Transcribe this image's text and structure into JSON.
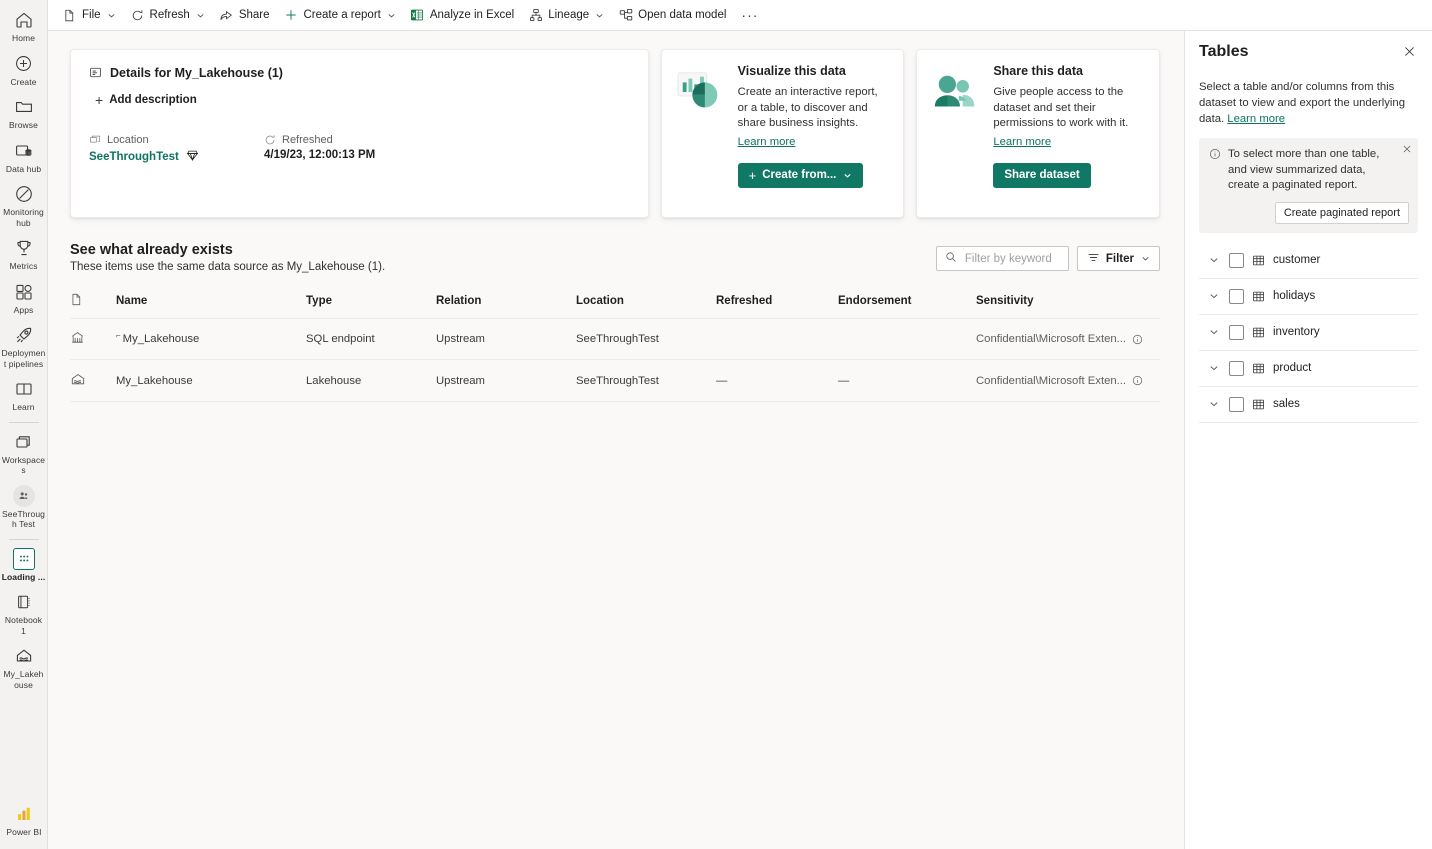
{
  "rail": {
    "items": [
      {
        "label": "Home",
        "icon": "home-icon",
        "active": false
      },
      {
        "label": "Create",
        "icon": "create-plus-icon",
        "active": false
      },
      {
        "label": "Browse",
        "icon": "folder-icon",
        "active": false
      },
      {
        "label": "Data hub",
        "icon": "data-hub-icon",
        "active": false
      },
      {
        "label": "Monitoring hub",
        "icon": "monitoring-hub-icon",
        "active": false
      },
      {
        "label": "Metrics",
        "icon": "trophy-icon",
        "active": false
      },
      {
        "label": "Apps",
        "icon": "apps-grid-icon",
        "active": false
      },
      {
        "label": "Deployment pipelines",
        "icon": "deployment-pipelines-icon",
        "active": false
      },
      {
        "label": "Learn",
        "icon": "book-icon",
        "active": false
      }
    ],
    "items2": [
      {
        "label": "Workspaces",
        "icon": "workspaces-icon",
        "active": false
      },
      {
        "label": "SeeThrough Test",
        "icon": "workspace-avatar-icon",
        "active": false
      }
    ],
    "items3": [
      {
        "label": "Loading ...",
        "icon": "dataset-icon",
        "active": true
      },
      {
        "label": "Notebook 1",
        "icon": "notebook-icon",
        "active": false
      },
      {
        "label": "My_Lakehouse",
        "icon": "lakehouse-icon",
        "active": false
      }
    ],
    "footer": {
      "label": "Power BI",
      "icon": "power-bi-logo-icon"
    }
  },
  "toolbar": {
    "items": [
      {
        "label": "File",
        "icon": "file-icon",
        "chevron": true
      },
      {
        "label": "Refresh",
        "icon": "refresh-icon",
        "chevron": true
      },
      {
        "label": "Share",
        "icon": "share-icon",
        "chevron": false
      },
      {
        "label": "Create a report",
        "icon": "plus-icon",
        "chevron": true
      },
      {
        "label": "Analyze in Excel",
        "icon": "excel-icon",
        "chevron": false
      },
      {
        "label": "Lineage",
        "icon": "lineage-icon",
        "chevron": true
      },
      {
        "label": "Open data model",
        "icon": "data-model-icon",
        "chevron": false
      }
    ],
    "overflow_label": "···"
  },
  "details": {
    "title": "Details for My_Lakehouse (1)",
    "add_description": "Add description",
    "location_label": "Location",
    "location_value": "SeeThroughTest",
    "refreshed_label": "Refreshed",
    "refreshed_value": "4/19/23, 12:00:13 PM"
  },
  "promos": [
    {
      "title": "Visualize this data",
      "text": "Create an interactive report, or a table, to discover and share business insights.",
      "link": "Learn more",
      "button": "Create from...",
      "icon": "chart-pie-icon",
      "has_plus": true,
      "has_chevron": true
    },
    {
      "title": "Share this data",
      "text": "Give people access to the dataset and set their permissions to work with it.",
      "link": "Learn more",
      "button": "Share dataset",
      "icon": "people-icon",
      "has_plus": false,
      "has_chevron": false
    }
  ],
  "existing": {
    "title": "See what already exists",
    "subtitle": "These items use the same data source as My_Lakehouse (1).",
    "search_placeholder": "Filter by keyword",
    "search_value": "",
    "filter_label": "Filter",
    "columns": [
      "",
      "Name",
      "Type",
      "Relation",
      "Location",
      "Refreshed",
      "Endorsement",
      "Sensitivity"
    ],
    "rows": [
      {
        "icon": "sql-endpoint-icon",
        "name": "My_Lakehouse",
        "type": "SQL endpoint",
        "relation": "Upstream",
        "location": "SeeThroughTest",
        "refreshed": "",
        "endorsement": "",
        "sensitivity": "Confidential\\Microsoft Exten..."
      },
      {
        "icon": "lakehouse-icon",
        "name": "My_Lakehouse",
        "type": "Lakehouse",
        "relation": "Upstream",
        "location": "SeeThroughTest",
        "refreshed": "—",
        "endorsement": "—",
        "sensitivity": "Confidential\\Microsoft Exten..."
      }
    ]
  },
  "tables_panel": {
    "title": "Tables",
    "close_icon": "close-icon",
    "description": "Select a table and/or columns from this dataset to view and export the underlying data.",
    "description_link": "Learn more",
    "note": "To select more than one table, and view summarized data, create a paginated report.",
    "note_button": "Create paginated report",
    "tables": [
      {
        "name": "customer",
        "checked": false
      },
      {
        "name": "holidays",
        "checked": false
      },
      {
        "name": "inventory",
        "checked": false
      },
      {
        "name": "product",
        "checked": false
      },
      {
        "name": "sales",
        "checked": false
      }
    ]
  },
  "colors": {
    "accent_green": "#117865",
    "link_green": "#0f7362",
    "canvas": "#faf9f8",
    "rail": "#f3f2f1"
  }
}
